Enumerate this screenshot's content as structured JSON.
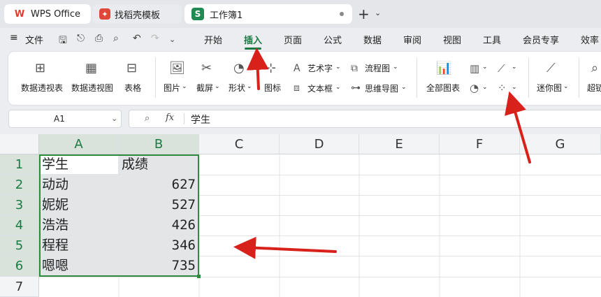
{
  "tabs": {
    "wps": "WPS Office",
    "template": "找稻壳模板",
    "workbook": "工作簿1"
  },
  "menu": {
    "file": "文件",
    "items": [
      "开始",
      "插入",
      "页面",
      "公式",
      "数据",
      "审阅",
      "视图",
      "工具",
      "会员专享",
      "效率"
    ],
    "active": "插入"
  },
  "ribbon": {
    "pivot_table": "数据透视表",
    "pivot_chart": "数据透视图",
    "table": "表格",
    "picture": "图片",
    "screenshot": "截屏",
    "shape": "形状",
    "icon": "图标",
    "art_text": "艺术字",
    "text_box": "文本框",
    "flowchart": "流程图",
    "mindmap": "思维导图",
    "all_charts": "全部图表",
    "sparkline": "迷你图",
    "hyperlink": "超链"
  },
  "formula_bar": {
    "cell_ref": "A1",
    "fx": "fx",
    "value": "学生"
  },
  "grid": {
    "columns": [
      "A",
      "B",
      "C",
      "D",
      "E",
      "F",
      "G"
    ],
    "rows": [
      "1",
      "2",
      "3",
      "4",
      "5",
      "6",
      "7"
    ],
    "header": {
      "a": "学生",
      "b": "成绩"
    },
    "data": [
      {
        "name": "动动",
        "score": "627"
      },
      {
        "name": "妮妮",
        "score": "527"
      },
      {
        "name": "浩浩",
        "score": "426"
      },
      {
        "name": "程程",
        "score": "346"
      },
      {
        "name": "嗯嗯",
        "score": "735"
      }
    ]
  },
  "colors": {
    "accent": "#1b7a42",
    "selection_border": "#2e8b3e",
    "arrow": "#d9211c"
  }
}
